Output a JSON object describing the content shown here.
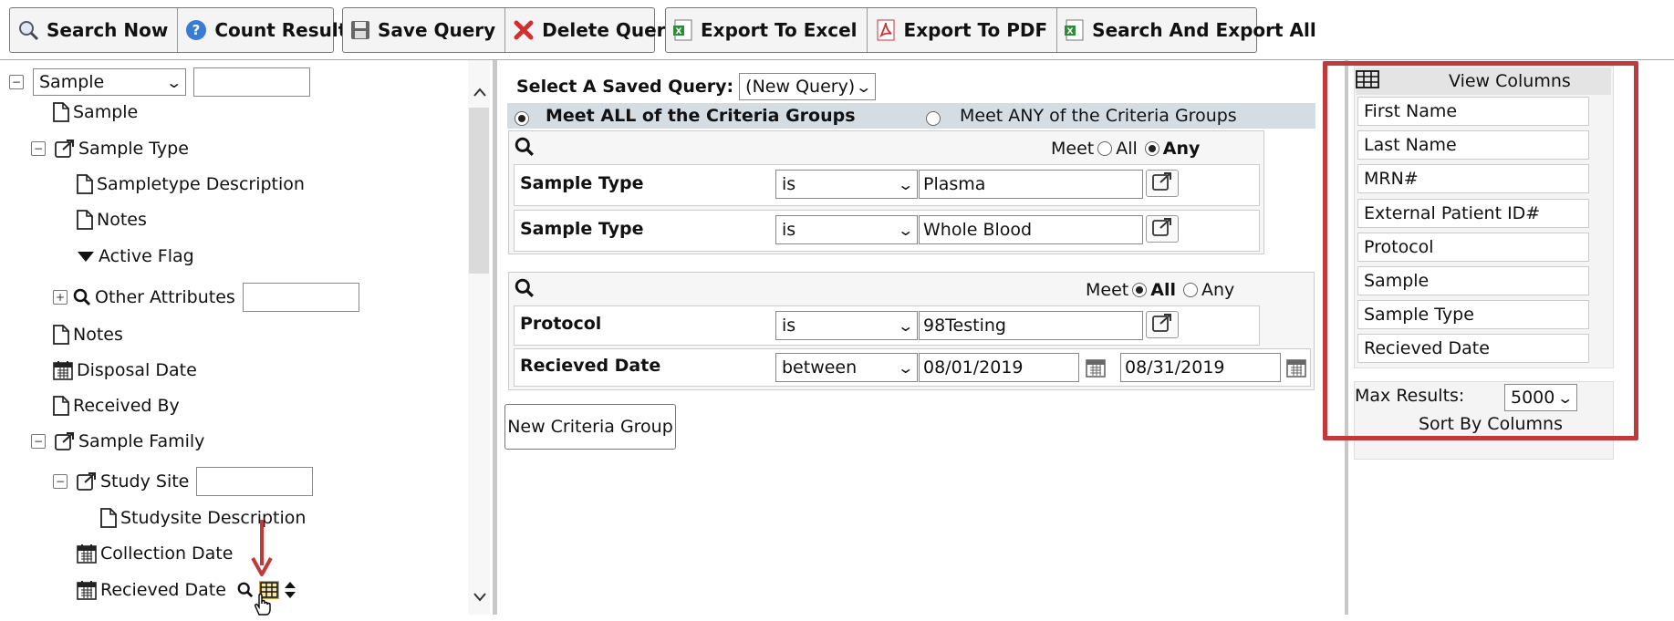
{
  "toolbar": {
    "search_now": "Search Now",
    "count_results": "Count Results",
    "save_query": "Save Query",
    "delete_query": "Delete Query",
    "export_excel": "Export To Excel",
    "export_pdf": "Export To PDF",
    "search_export_all": "Search And Export All"
  },
  "tree": {
    "root_select": "Sample",
    "items": {
      "sample": "Sample",
      "sample_type": "Sample Type",
      "sampletype_description": "Sampletype Description",
      "notes1": "Notes",
      "active_flag": "Active Flag",
      "other_attributes": "Other Attributes",
      "notes2": "Notes",
      "disposal_date": "Disposal Date",
      "received_by": "Received By",
      "sample_family": "Sample Family",
      "study_site": "Study Site",
      "studysite_description": "Studysite Description",
      "collection_date": "Collection Date",
      "recieved_date": "Recieved Date"
    }
  },
  "query": {
    "saved_label": "Select A Saved Query:",
    "saved_value": "(New Query)",
    "meet_all_groups": "Meet ALL of the Criteria Groups",
    "meet_any_groups": "Meet ANY of the Criteria Groups",
    "group1": {
      "meet": "Meet",
      "all": "All",
      "any": "Any",
      "rows": [
        {
          "field": "Sample Type",
          "op": "is",
          "value": "Plasma"
        },
        {
          "field": "Sample Type",
          "op": "is",
          "value": "Whole Blood"
        }
      ]
    },
    "group2": {
      "meet": "Meet",
      "all": "All",
      "any": "Any",
      "rows": [
        {
          "field": "Protocol",
          "op": "is",
          "value": "98Testing"
        },
        {
          "field": "Recieved Date",
          "op": "between",
          "value": "08/01/2019",
          "value2": "08/31/2019"
        }
      ]
    },
    "new_group": "New Criteria Group"
  },
  "columns": {
    "title": "View Columns",
    "items": [
      "First Name",
      "Last Name",
      "MRN#",
      "External Patient ID#",
      "Protocol",
      "Sample",
      "Sample Type",
      "Recieved Date"
    ],
    "max_results_label": "Max Results:",
    "max_results_value": "5000",
    "sort_by": "Sort By Columns"
  },
  "colors": {
    "highlight_box": "#c0393b",
    "arrow": "#c0393b",
    "query_header_bg": "#d5dde4"
  }
}
